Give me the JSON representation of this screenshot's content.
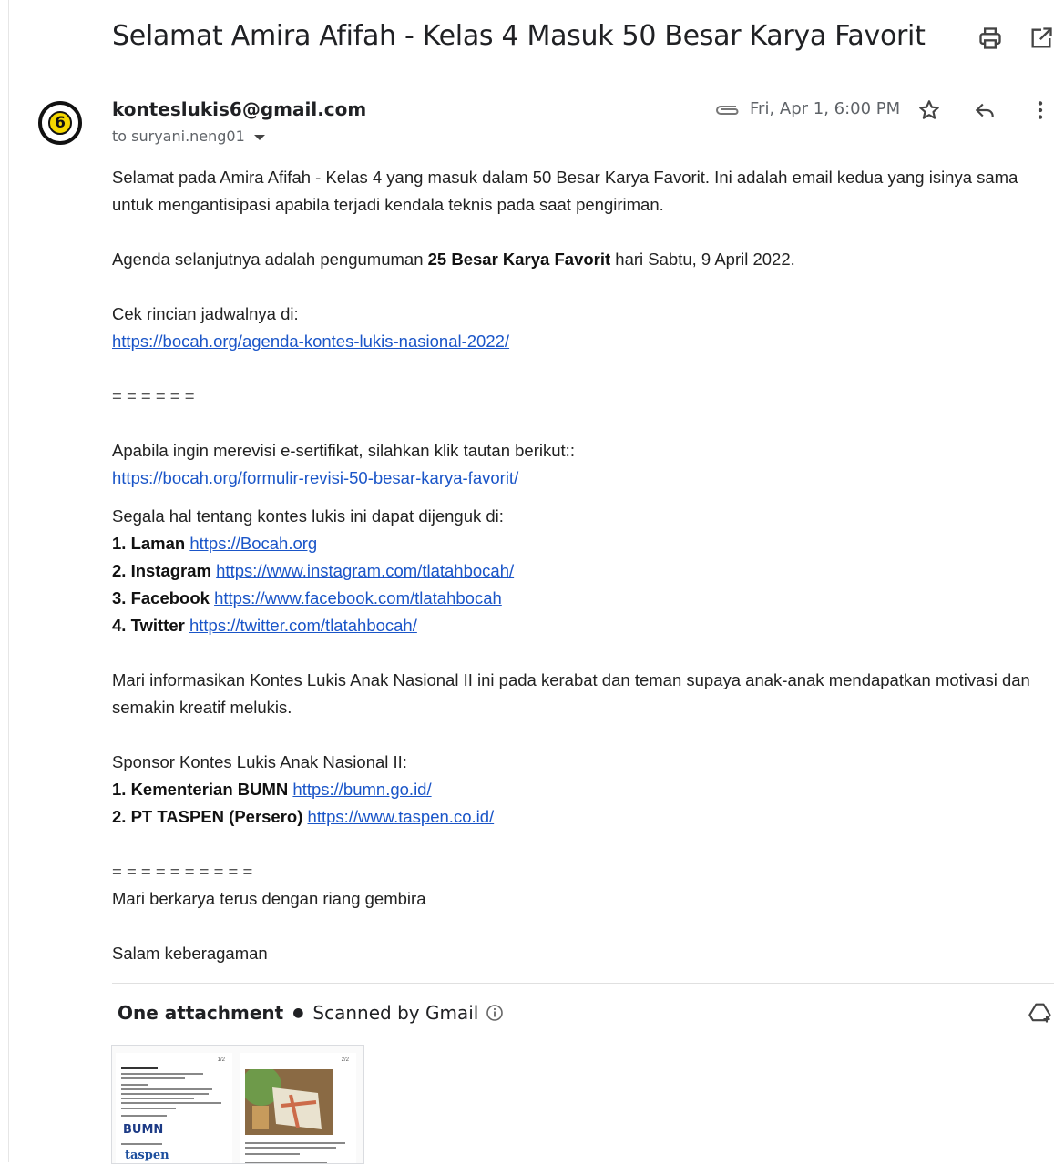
{
  "email": {
    "subject": "Selamat Amira Afifah - Kelas 4 Masuk 50 Besar Karya Favorit",
    "sender": "konteslukis6@gmail.com",
    "to_label": "to suryani.neng01",
    "date": "Fri, Apr 1, 6:00 PM",
    "avatar_label": "6"
  },
  "body": {
    "p1": "Selamat pada Amira Afifah - Kelas 4 yang masuk dalam 50 Besar Karya Favorit. Ini adalah email kedua yang isinya sama untuk mengantisipasi apabila terjadi kendala teknis pada saat pengiriman.",
    "agenda_prefix": "Agenda selanjutnya adalah pengumuman ",
    "agenda_bold": "25 Besar Karya Favorit",
    "agenda_suffix": " hari Sabtu, 9 April 2022.",
    "cek_label": "Cek rincian jadwalnya di:",
    "link_agenda": "https://bocah.org/agenda-kontes-lukis-nasional-2022/",
    "separator1": "= = = = = =",
    "revisi_text": "Apabila ingin merevisi e-sertifikat, silahkan klik tautan berikut::",
    "link_revisi": "https://bocah.org/formulir-revisi-50-besar-karya-favorit/",
    "segala_text": "Segala hal tentang kontes lukis ini dapat dijenguk di:",
    "links": [
      {
        "label": "1. Laman",
        "url": "https://Bocah.org"
      },
      {
        "label": "2. Instagram",
        "url": "https://www.instagram.com/tlatahbocah/"
      },
      {
        "label": "3. Facebook",
        "url": "https://www.facebook.com/tlatahbocah"
      },
      {
        "label": "4. Twitter",
        "url": "https://twitter.com/tlatahbocah/"
      }
    ],
    "mari_text": "Mari informasikan Kontes Lukis Anak Nasional II ini pada kerabat dan teman supaya anak-anak mendapatkan motivasi dan semakin kreatif melukis.",
    "sponsor_label": "Sponsor Kontes Lukis Anak Nasional II:",
    "sponsors": [
      {
        "label": "1. Kementerian BUMN",
        "url": "https://bumn.go.id/"
      },
      {
        "label": "2. PT TASPEN (Persero)",
        "url": "https://www.taspen.co.id/"
      }
    ],
    "separator2": "= = = = = = = = = =",
    "closing1": "Mari berkarya terus dengan riang gembira",
    "closing2": "Salam keberagaman"
  },
  "attachment": {
    "count_label": "One attachment",
    "scan_label": "Scanned by Gmail",
    "thumb_logo1": "BUMN",
    "thumb_logo2": "taspen"
  },
  "colors": {
    "link": "#1a55c8",
    "avatar_fill": "#f5d800"
  }
}
